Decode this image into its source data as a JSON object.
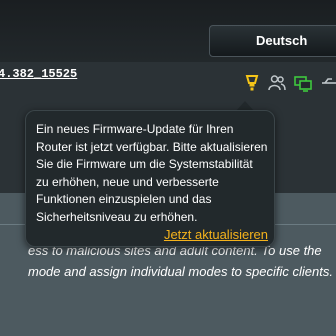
{
  "header": {
    "language_button": "Deutsch"
  },
  "status_bar": {
    "firmware_version": "4.382_15525",
    "icons": [
      "firmware-update-icon",
      "users-icon",
      "network-monitor-icon",
      "usb-icon"
    ]
  },
  "tooltip": {
    "message": "Ein neues Firmware-Update für Ihren Router ist jetzt verfügbar. Bitte aktualisieren Sie die Firmware um die Systemstabilität zu erhöhen, neue und verbesserte Funktionen einzuspielen und das Sicherheitsniveau zu erhöhen.",
    "link": "Jetzt aktualisieren"
  },
  "content": {
    "line1": "ess to malicious sites and adult content. To use the",
    "line2": "mode and assign individual modes to specific clients."
  },
  "colors": {
    "accent": "#f5b31c",
    "active_icon": "#3ec93e"
  }
}
